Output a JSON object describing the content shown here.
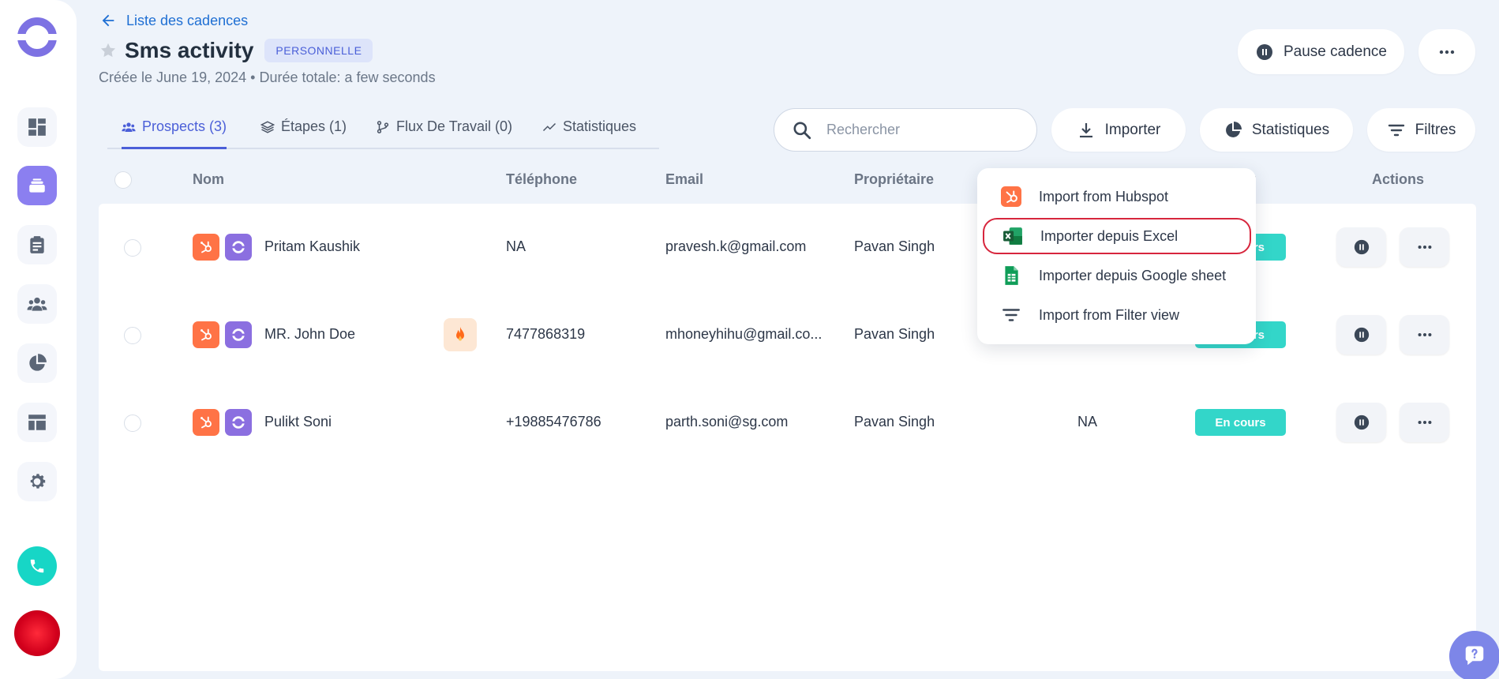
{
  "header": {
    "back_label": "Liste des cadences",
    "title": "Sms activity",
    "badge": "PERSONNELLE",
    "subtitle": "Créée le June 19, 2024 • Durée totale: a few seconds",
    "pause_label": "Pause cadence"
  },
  "tabs": [
    {
      "label": "Prospects (3)",
      "active": true,
      "icon": "people-icon"
    },
    {
      "label": "Étapes (1)",
      "active": false,
      "icon": "layers-icon"
    },
    {
      "label": "Flux De Travail (0)",
      "active": false,
      "icon": "workflow-icon"
    },
    {
      "label": "Statistiques",
      "active": false,
      "icon": "trend-icon"
    }
  ],
  "toolbar": {
    "search_placeholder": "Rechercher",
    "import_label": "Importer",
    "stats_label": "Statistiques",
    "filters_label": "Filtres"
  },
  "table": {
    "columns": {
      "name": "Nom",
      "phone": "Téléphone",
      "email": "Email",
      "owner": "Propriétaire",
      "status_partial": "t",
      "actions": "Actions"
    },
    "rows": [
      {
        "name": "Pritam Kaushik",
        "phone": "NA",
        "email": "pravesh.k@gmail.com",
        "owner": "Pavan Singh",
        "status": "rs",
        "hot": false,
        "extra": ""
      },
      {
        "name": "MR. John Doe",
        "phone": "7477868319",
        "email": "mhoneyhihu@gmail.co...",
        "owner": "Pavan Singh",
        "status": "rs",
        "hot": true,
        "extra": ""
      },
      {
        "name": "Pulikt Soni",
        "phone": "+19885476786",
        "email": "parth.soni@sg.com",
        "owner": "Pavan Singh",
        "status": "En cours",
        "hot": false,
        "extra": "NA"
      }
    ]
  },
  "import_menu": [
    {
      "label": "Import from Hubspot",
      "icon": "hubspot-icon"
    },
    {
      "label": "Importer depuis Excel",
      "icon": "excel-icon",
      "highlighted": true
    },
    {
      "label": "Importer depuis Google sheet",
      "icon": "google-sheets-icon"
    },
    {
      "label": "Import from Filter view",
      "icon": "filter-icon"
    }
  ],
  "colors": {
    "accent": "#4b5fd8",
    "status": "#33d6c9",
    "hubspot": "#ff7346",
    "cadence": "#8b6fe0",
    "highlight_border": "#d7263d"
  }
}
